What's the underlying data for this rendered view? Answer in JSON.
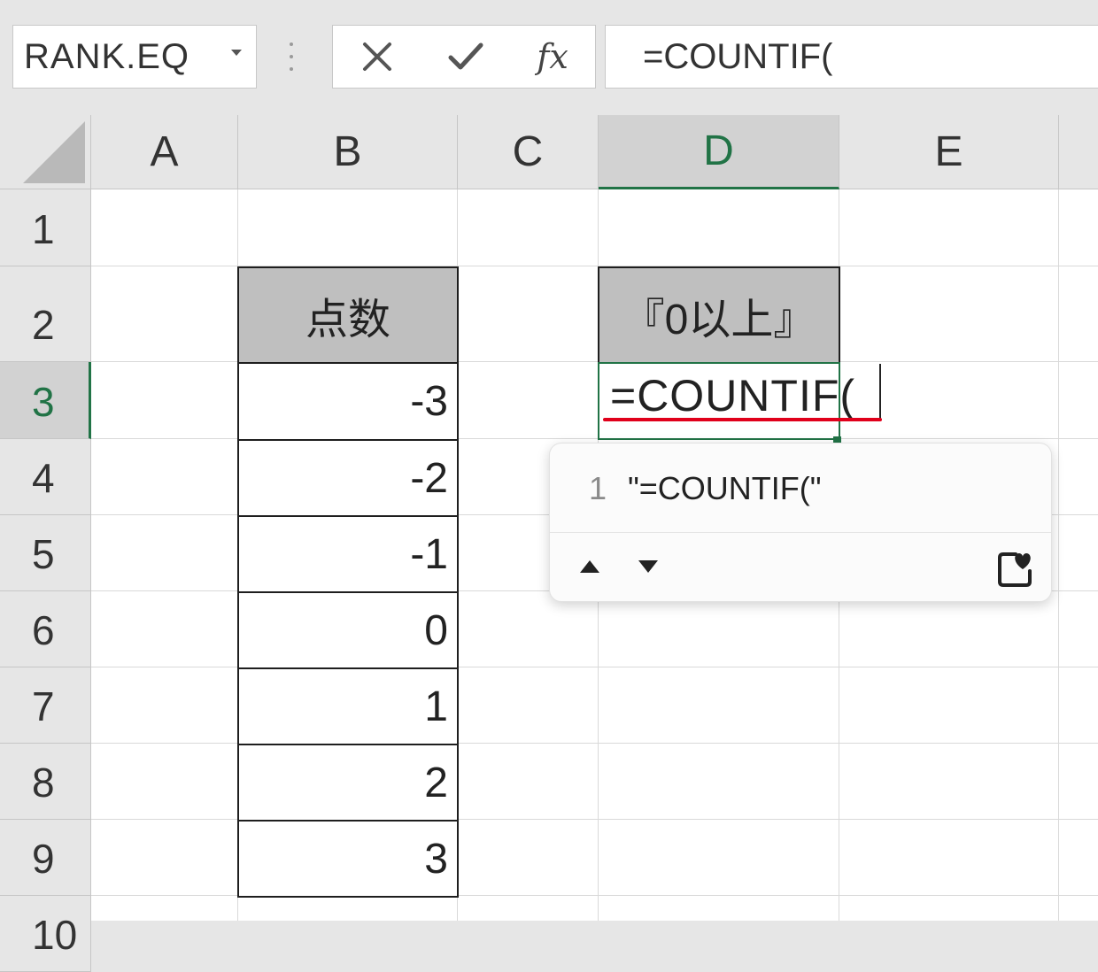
{
  "formula_bar": {
    "name_box": "RANK.EQ",
    "cancel_icon": "x-icon",
    "enter_icon": "check-icon",
    "function_label": "fx",
    "formula": "=COUNTIF("
  },
  "columns": [
    "A",
    "B",
    "C",
    "D",
    "E"
  ],
  "active_column": "D",
  "rows": [
    "1",
    "2",
    "3",
    "4",
    "5",
    "6",
    "7",
    "8",
    "9",
    "10"
  ],
  "active_row": "3",
  "cells": {
    "B2": "点数",
    "B3": "-3",
    "B4": "-2",
    "B5": "-1",
    "B6": "0",
    "B7": "1",
    "B8": "2",
    "B9": "3",
    "D2": "『0以上』",
    "D3": "=COUNTIF("
  },
  "autocomplete": {
    "index": "1",
    "suggestion": "\"=COUNTIF(\"",
    "nav_icons": [
      "triangle-up-icon",
      "triangle-down-icon"
    ],
    "favorite_icon": "favorite-heart-icon"
  },
  "colors": {
    "accent_green": "#217346",
    "header_fill": "#bfbfbf",
    "error_underline": "#e0001b"
  }
}
